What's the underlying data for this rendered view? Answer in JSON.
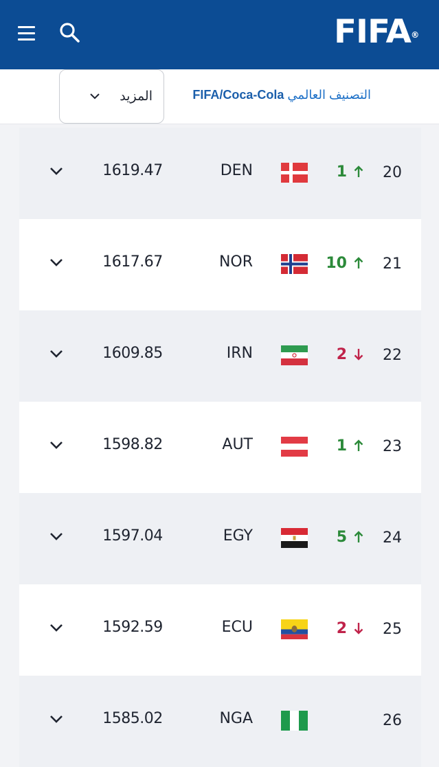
{
  "header": {
    "logo": "FIFA",
    "logo_mark": "®",
    "menu_icon": "hamburger-menu-icon",
    "search_icon": "search-icon",
    "bg_color": "#0c4c94"
  },
  "subbar": {
    "title_prefix": "التصنيف العالمي",
    "title_brand": "FIFA/Coca-Cola",
    "more_label": "المزيد"
  },
  "colors": {
    "up": "#2c8a3a",
    "down": "#c0234a",
    "link": "#1b6fc7"
  },
  "rows": [
    {
      "rank": "20",
      "movement": "1",
      "direction": "up",
      "code": "DEN",
      "points": "1619.47",
      "flag": "denmark-flag"
    },
    {
      "rank": "21",
      "movement": "10",
      "direction": "up",
      "code": "NOR",
      "points": "1617.67",
      "flag": "norway-flag"
    },
    {
      "rank": "22",
      "movement": "2",
      "direction": "down",
      "code": "IRN",
      "points": "1609.85",
      "flag": "iran-flag"
    },
    {
      "rank": "23",
      "movement": "1",
      "direction": "up",
      "code": "AUT",
      "points": "1598.82",
      "flag": "austria-flag"
    },
    {
      "rank": "24",
      "movement": "5",
      "direction": "up",
      "code": "EGY",
      "points": "1597.04",
      "flag": "egypt-flag"
    },
    {
      "rank": "25",
      "movement": "2",
      "direction": "down",
      "code": "ECU",
      "points": "1592.59",
      "flag": "ecuador-flag"
    },
    {
      "rank": "26",
      "movement": "",
      "direction": "none",
      "code": "NGA",
      "points": "1585.02",
      "flag": "nigeria-flag"
    }
  ]
}
